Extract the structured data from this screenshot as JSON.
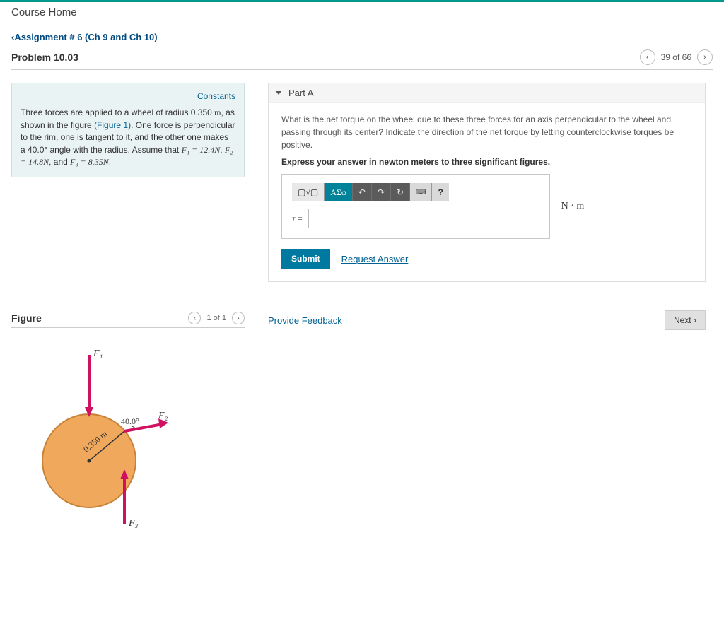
{
  "header": {
    "course_home": "Course Home"
  },
  "assignment_link": "Assignment # 6 (Ch 9 and Ch 10)",
  "problem_title": "Problem 10.03",
  "pager": {
    "label": "39 of 66"
  },
  "problem": {
    "constants_link": "Constants",
    "intro_1": "Three forces are applied to a wheel of radius 0.350 ",
    "unit_m": "m",
    "intro_2": ", as shown in the figure ",
    "figure_ref": "(Figure 1)",
    "intro_3": ". One force is perpendicular to the rim, one is tangent to it, and the other one makes a 40.0° angle with the radius. Assume that ",
    "f1": "F₁ = 12.4N",
    "sep1": ", ",
    "f2": "F₂ = 14.8N",
    "sep2": ", and ",
    "f3": "F₃ = 8.35N",
    "period": "."
  },
  "partA": {
    "label": "Part A",
    "question": "What is the net torque on the wheel due to these three forces for an axis perpendicular to the wheel and passing through its center? Indicate the direction of the net torque by letting counterclockwise torques be positive.",
    "instruction": "Express your answer in newton meters to three significant figures.",
    "tau": "τ =",
    "unit": "N · m",
    "submit": "Submit",
    "request_answer": "Request Answer",
    "toolbar": {
      "sqrt": "▢√▢",
      "greek": "ΑΣφ",
      "undo": "↶",
      "redo": "↷",
      "reset": "↻",
      "keyboard": "⌨",
      "help": "?"
    }
  },
  "feedback": {
    "provide": "Provide Feedback",
    "next": "Next"
  },
  "figure": {
    "title": "Figure",
    "pager": "1 of 1",
    "radius_label": "0.350 m",
    "angle_label": "40.0°",
    "F1": "F₁",
    "F2": "F₂",
    "F3": "F₃"
  }
}
